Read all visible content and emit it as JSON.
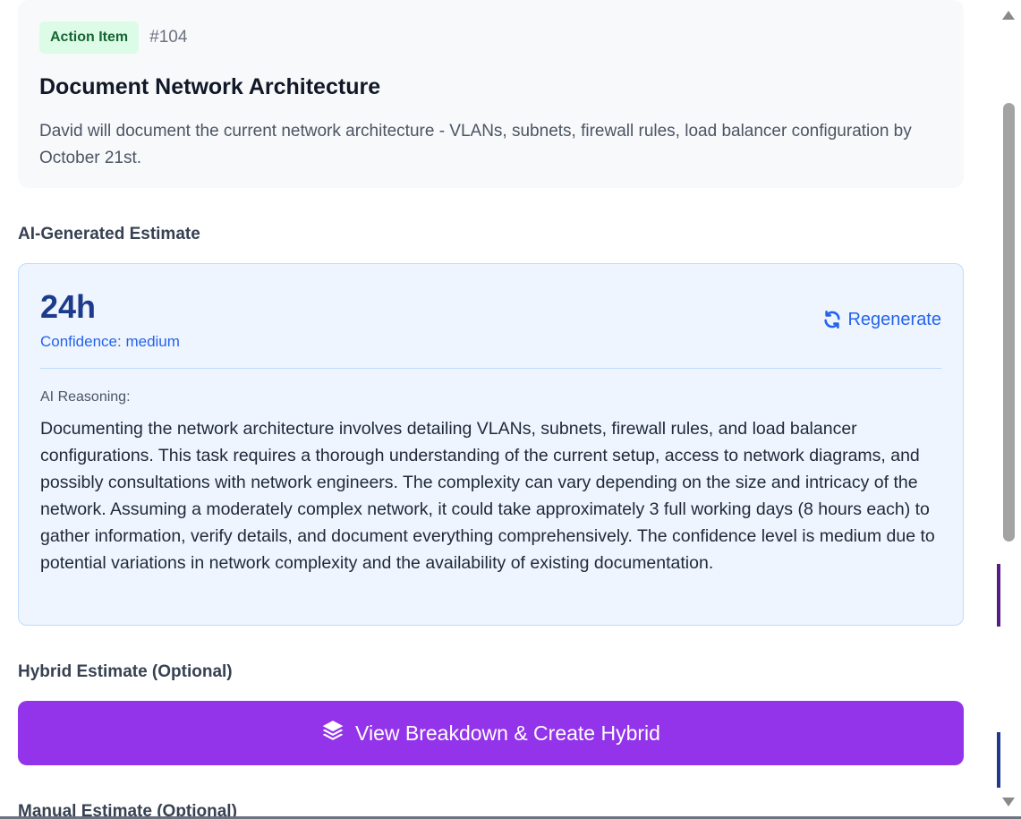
{
  "item": {
    "badge": "Action Item",
    "id": "#104",
    "title": "Document Network Architecture",
    "description": "David will document the current network architecture - VLANs, subnets, firewall rules, load balancer configuration by October 21st."
  },
  "ai_estimate": {
    "heading": "AI-Generated Estimate",
    "value": "24h",
    "confidence": "Confidence: medium",
    "regenerate_label": "Regenerate",
    "regenerate_icon": "refresh-icon",
    "reasoning_label": "AI Reasoning:",
    "reasoning_text": "Documenting the network architecture involves detailing VLANs, subnets, firewall rules, and load balancer configurations. This task requires a thorough understanding of the current setup, access to network diagrams, and possibly consultations with network engineers. The complexity can vary depending on the size and intricacy of the network. Assuming a moderately complex network, it could take approximately 3 full working days (8 hours each) to gather information, verify details, and document everything comprehensively. The confidence level is medium due to potential variations in network complexity and the availability of existing documentation."
  },
  "hybrid": {
    "heading": "Hybrid Estimate (Optional)",
    "button_label": "View Breakdown & Create Hybrid",
    "button_icon": "layers-icon"
  },
  "manual": {
    "heading": "Manual Estimate (Optional)"
  },
  "colors": {
    "badge_bg": "#dcfce7",
    "badge_text": "#166534",
    "ai_card_bg": "#eef5ff",
    "accent_blue": "#2563eb",
    "estimate_value": "#1e3a8a",
    "hybrid_button": "#9333ea"
  }
}
